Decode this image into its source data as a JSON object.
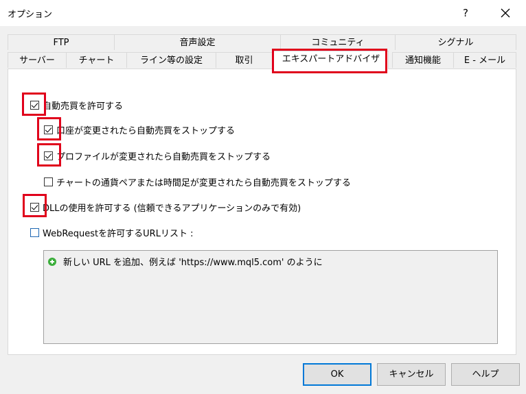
{
  "window": {
    "title": "オプション",
    "help_label": "?"
  },
  "tabs_row1": [
    "FTP",
    "音声設定",
    "コミュニティ",
    "シグナル"
  ],
  "tabs_row2": [
    "サーバー",
    "チャート",
    "ライン等の設定",
    "取引",
    "エキスパートアドバイザ",
    "通知機能",
    "E - メール"
  ],
  "active_tab": "エキスパートアドバイザ",
  "options": {
    "allow_auto_trading": {
      "label": "自動売買を許可する",
      "checked": true
    },
    "stop_on_account_change": {
      "label": "口座が変更されたら自動売買をストップする",
      "checked": true
    },
    "stop_on_profile_change": {
      "label": "プロファイルが変更されたら自動売買をストップする",
      "checked": true
    },
    "stop_on_symbol_change": {
      "label": "チャートの通貨ペアまたは時間足が変更されたら自動売買をストップする",
      "checked": false
    },
    "allow_dll": {
      "label": "DLLの使用を許可する (信頼できるアプリケーションのみで有効)",
      "checked": true
    },
    "allow_webrequest": {
      "label": "WebRequestを許可するURLリスト :",
      "checked": false
    }
  },
  "url_list": {
    "add_hint": "新しい URL を追加、例えば 'https://www.mql5.com' のように"
  },
  "buttons": {
    "ok": "OK",
    "cancel": "キャンセル",
    "help": "ヘルプ"
  },
  "colors": {
    "highlight": "#e0001b",
    "default_button_border": "#0078d7",
    "add_icon": "#3cae3c"
  }
}
